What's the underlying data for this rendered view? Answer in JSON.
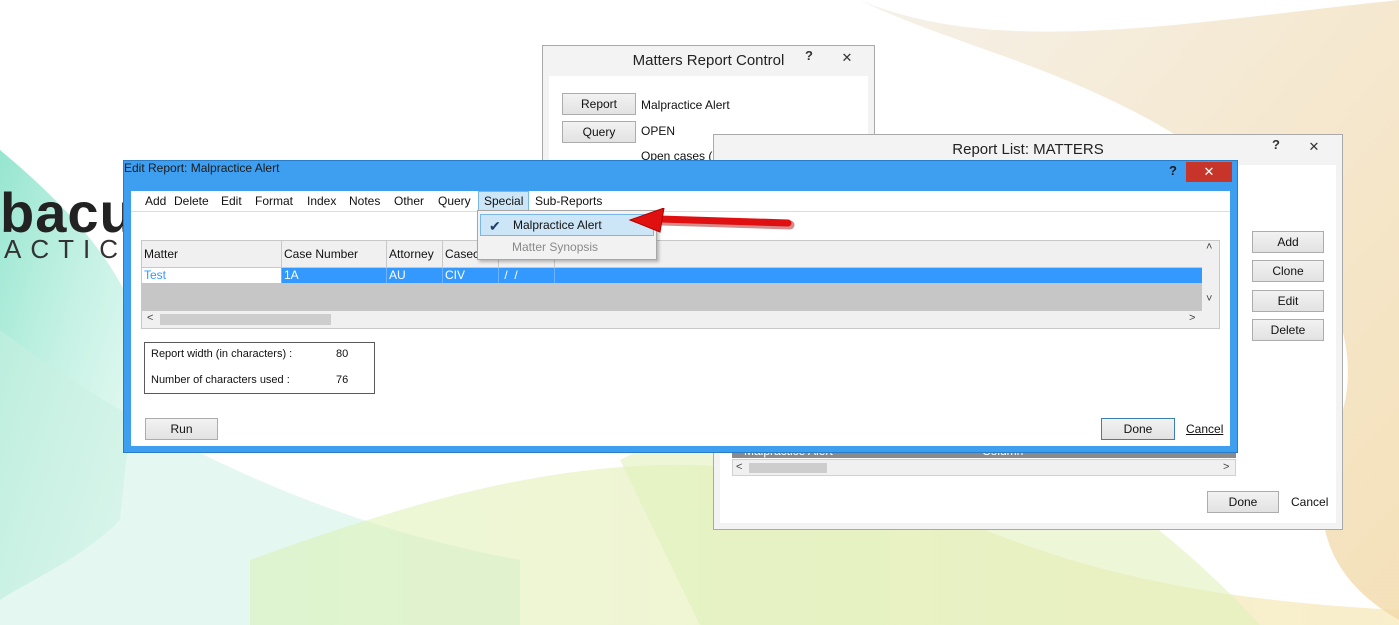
{
  "logo": {
    "part1": "bacu",
    "part2": "ACTICE"
  },
  "matters_report_control": {
    "title": "Matters Report Control",
    "help": "?",
    "close": "✕",
    "report_button": "Report",
    "report_value": "Malpractice Alert",
    "query_button": "Query",
    "query_value": "OPEN",
    "query_desc": "Open cases ('C"
  },
  "report_list": {
    "title": "Report List: MATTERS",
    "help": "?",
    "close": "✕",
    "buttons": {
      "add": "Add",
      "clone": "Clone",
      "edit": "Edit",
      "delete": "Delete"
    },
    "row_name": "Malpractice Alert",
    "row_type": "Column",
    "done": "Done",
    "cancel": "Cancel"
  },
  "edit_report": {
    "title": "Edit Report: Malpractice Alert",
    "help": "?",
    "close": "✕",
    "menu": [
      "Add",
      "Delete",
      "Edit",
      "Format",
      "Index",
      "Notes",
      "Other",
      "Query",
      "Special",
      "Sub-Reports"
    ],
    "active_menu": "Special",
    "columns": [
      "Matter",
      "Case Number",
      "Attorney",
      "Caseco",
      ""
    ],
    "row": [
      "Test",
      "1A",
      "AU",
      "CIV",
      " /  /"
    ],
    "report_width_label": "Report width (in characters) :",
    "report_width_value": "80",
    "chars_used_label": "Number of characters used :",
    "chars_used_value": "76",
    "run": "Run",
    "done": "Done",
    "cancel": "Cancel"
  },
  "special_menu": {
    "items": [
      {
        "label": "Malpractice Alert",
        "checked": true,
        "enabled": true
      },
      {
        "label": "Matter Synopsis",
        "checked": false,
        "enabled": false
      }
    ]
  },
  "colors": {
    "accent": "#3399ff",
    "window_frame": "#3e9ff0",
    "arrow": "#e01010"
  }
}
